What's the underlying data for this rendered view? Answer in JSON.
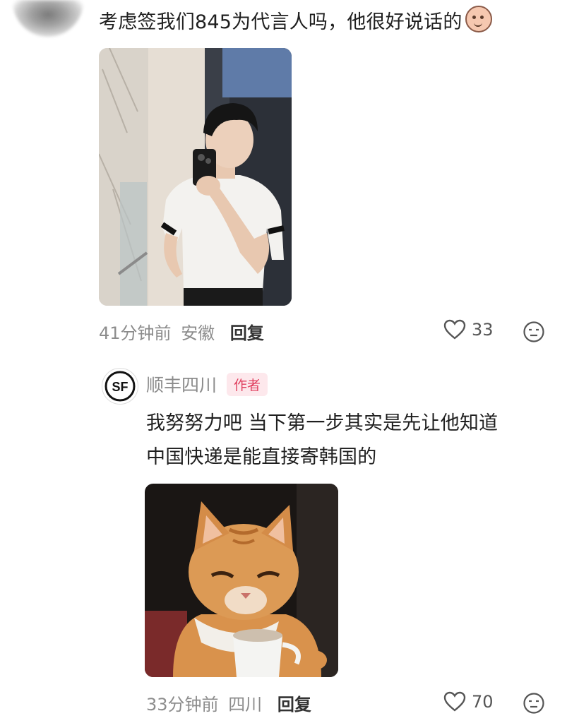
{
  "top_comment": {
    "text": "考虑签我们845为代言人吗，他很好说话的",
    "emoji_icon": "blushing-face-emoji",
    "time": "41分钟前",
    "location": "安徽",
    "reply_label": "回复",
    "likes": "33"
  },
  "reply_comment": {
    "username": "顺丰四川",
    "author_badge": "作者",
    "logo_text": "SF",
    "text_line1": "我努努力吧 当下第一步其实是先让他知道",
    "text_line2": "中国快递是能直接寄韩国的",
    "time": "33分钟前",
    "location": "四川",
    "reply_label": "回复",
    "likes": "70"
  },
  "colors": {
    "meta_gray": "#8c8c8c",
    "badge_bg": "#fde8ec",
    "badge_text": "#e0405f"
  }
}
